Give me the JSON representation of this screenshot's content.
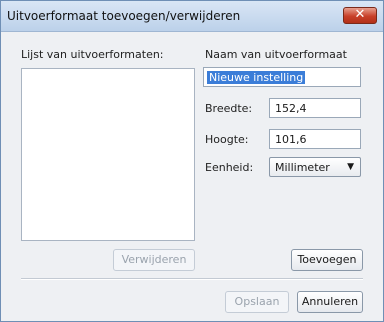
{
  "window": {
    "title": "Uitvoerformaat toevoegen/verwijderen",
    "close_glyph": "✕"
  },
  "left_panel": {
    "list_label": "Lijst van uitvoerformaten:",
    "list_items": [],
    "remove_button": "Verwijderen"
  },
  "right_panel": {
    "name_label": "Naam van uitvoerformaat",
    "name_value": "Nieuwe instelling",
    "width_label": "Breedte:",
    "width_value": "152,4",
    "height_label": "Hoogte:",
    "height_value": "101,6",
    "unit_label": "Eenheid:",
    "unit_value": "Millimeter",
    "add_button": "Toevoegen"
  },
  "footer": {
    "save_button": "Opslaan",
    "cancel_button": "Annuleren"
  },
  "icons": {
    "dropdown_arrow": "▼"
  }
}
